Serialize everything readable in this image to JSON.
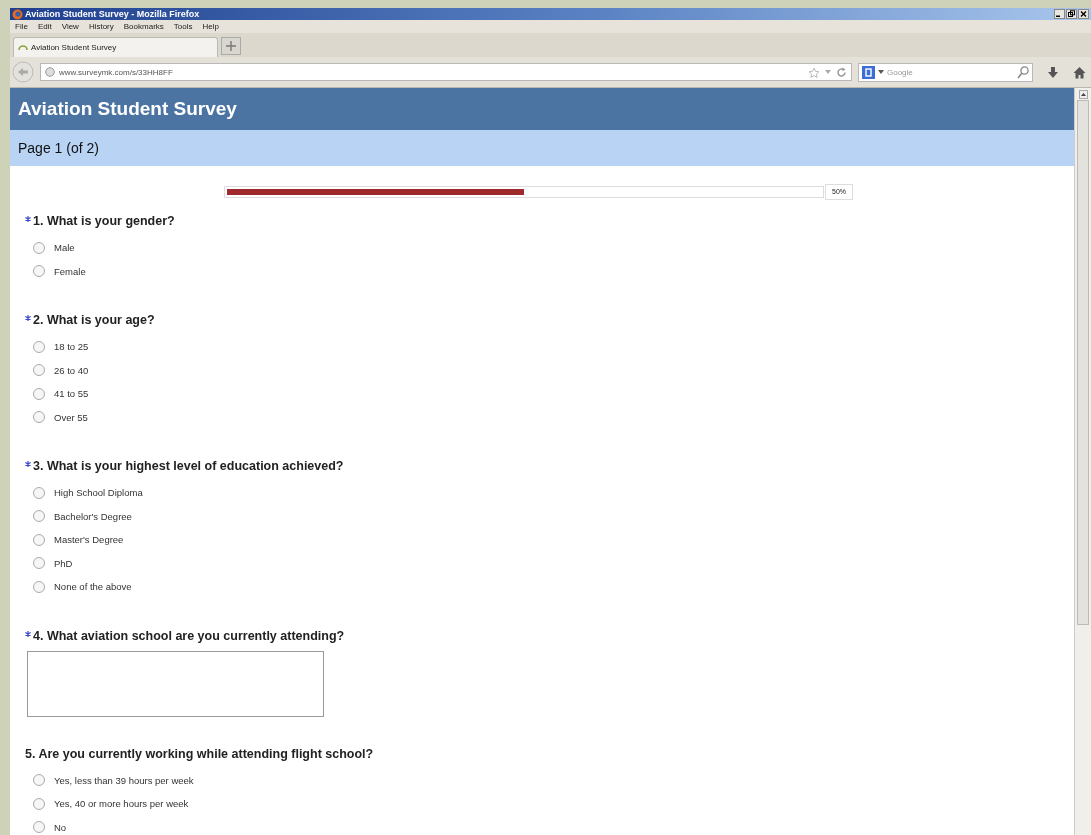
{
  "window": {
    "title": "Aviation Student Survey - Mozilla Firefox"
  },
  "menu": [
    "File",
    "Edit",
    "View",
    "History",
    "Bookmarks",
    "Tools",
    "Help"
  ],
  "tabs": [
    {
      "label": "Aviation Student Survey",
      "selected": true
    }
  ],
  "address_bar": {
    "url": "www.surveymk.com/s/33HH8FF"
  },
  "search": {
    "placeholder": "Google"
  },
  "survey": {
    "title": "Aviation Student Survey",
    "page": "Page 1 (of 2)",
    "progress": {
      "level": 0.5,
      "reading": "50%"
    },
    "questions": [
      {
        "kind": "radio",
        "required": true,
        "text": "1. What is your gender?",
        "options": [
          {
            "label": "Male",
            "selected": false
          },
          {
            "label": "Female",
            "selected": false
          }
        ]
      },
      {
        "kind": "radio",
        "required": true,
        "text": "2. What is your age?",
        "options": [
          {
            "label": "18 to 25",
            "selected": false
          },
          {
            "label": "26 to 40",
            "selected": false
          },
          {
            "label": "41 to 55",
            "selected": false
          },
          {
            "label": "Over 55",
            "selected": false
          }
        ]
      },
      {
        "kind": "radio",
        "required": true,
        "text": "3. What is your highest level of education achieved?",
        "options": [
          {
            "label": "High School Diploma",
            "selected": false
          },
          {
            "label": "Bachelor's Degree",
            "selected": false
          },
          {
            "label": "Master's Degree",
            "selected": false
          },
          {
            "label": "PhD",
            "selected": false
          },
          {
            "label": "None of the above",
            "selected": false
          }
        ]
      },
      {
        "kind": "text",
        "required": true,
        "text": "4. What aviation school are you currently attending?"
      },
      {
        "kind": "radio",
        "required": false,
        "text": "5. Are you currently working while attending flight school?",
        "options": [
          {
            "label": "Yes, less than 39 hours per week",
            "selected": false
          },
          {
            "label": "Yes, 40 or more hours per week",
            "selected": false
          },
          {
            "label": "No",
            "selected": false
          }
        ]
      }
    ]
  }
}
